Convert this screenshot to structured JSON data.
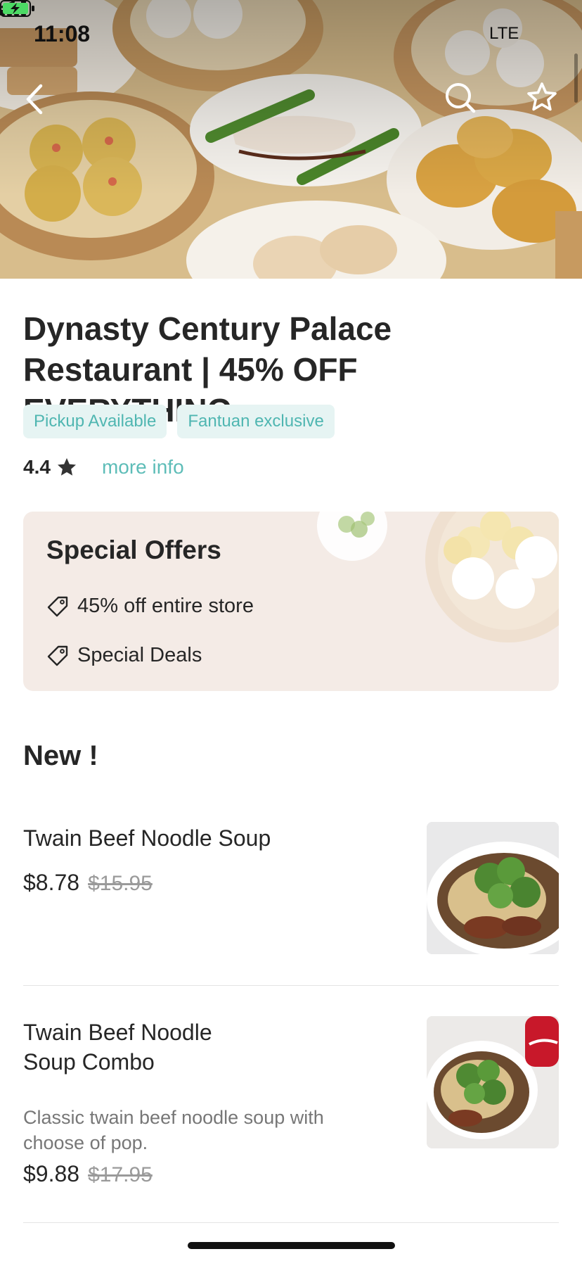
{
  "status_bar": {
    "time": "11:08",
    "carrier": "LTE",
    "battery_color": "#4cd964"
  },
  "nav": {
    "back_icon": "chevron-left-icon",
    "search_icon": "search-icon",
    "favorite_icon": "star-outline-icon"
  },
  "restaurant": {
    "name": "Dynasty Century Palace Restaurant | 45% OFF EVERYTHING",
    "tags": [
      "Pickup Available",
      "Fantuan exclusive"
    ],
    "rating": "4.4",
    "more_info_label": "more info"
  },
  "offers": {
    "title": "Special Offers",
    "items": [
      {
        "icon": "tag-icon",
        "label": "45% off entire store"
      },
      {
        "icon": "tag-icon",
        "label": "Special Deals"
      }
    ]
  },
  "menu": {
    "section_title": "New !",
    "items": [
      {
        "name": "Twain Beef Noodle Soup",
        "description": "",
        "price": "$8.78",
        "original_price": "$15.95"
      },
      {
        "name": "Twain Beef Noodle Soup Combo",
        "description": "Classic twain beef noodle soup with choose of pop.",
        "price": "$9.88",
        "original_price": "$17.95"
      }
    ]
  },
  "colors": {
    "accent": "#5ebdb8",
    "tag_bg": "#e6f4f3",
    "offers_bg": "#f4ebe6",
    "text": "#262626"
  }
}
